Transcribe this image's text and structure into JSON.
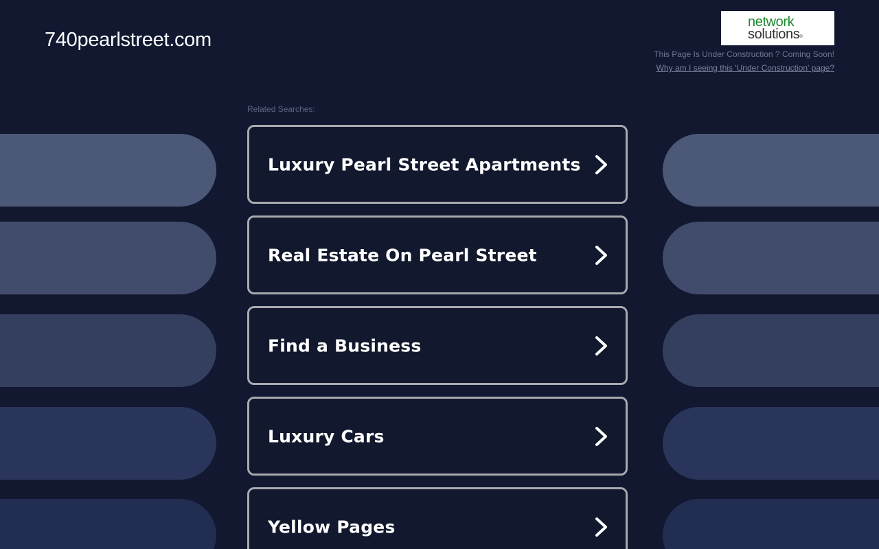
{
  "header": {
    "domain": "740pearlstreet.com",
    "logo": {
      "line1": "network",
      "line2": "solutions",
      "registered": "®"
    },
    "construction_text": "This Page Is Under Construction ? Coming Soon!",
    "why_link": "Why am I seeing this 'Under Construction' page?"
  },
  "related_label": "Related Searches:",
  "searches": [
    "Luxury Pearl Street Apartments",
    "Real Estate On Pearl Street",
    "Find a Business",
    "Luxury Cars",
    "Yellow Pages"
  ],
  "colors": {
    "background": "#111830",
    "card_border": "#a9a9b0",
    "logo_green": "#1e8a2e",
    "pill_shades": [
      "#4c5878",
      "#414c6c",
      "#343f5f",
      "#29355a",
      "#222d52"
    ]
  },
  "icons": {
    "card_arrow": "chevron-right-icon"
  }
}
